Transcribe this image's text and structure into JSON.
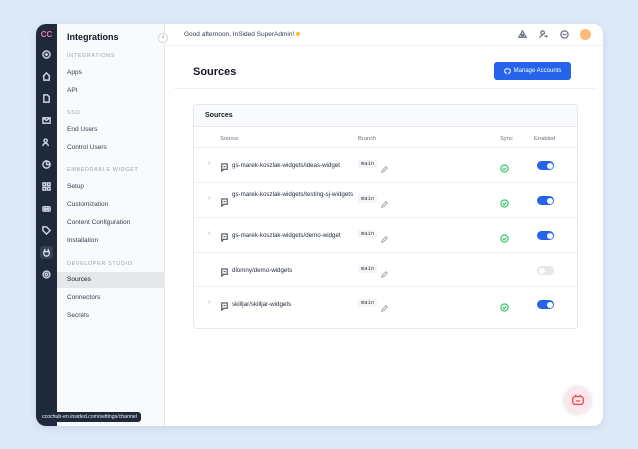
{
  "app": {
    "logo": "CC"
  },
  "nav": {
    "title": "Integrations",
    "collapse_glyph": "‹",
    "sections": [
      {
        "label": "INTEGRATIONS",
        "items": [
          "Apps",
          "API"
        ]
      },
      {
        "label": "SSO",
        "items": [
          "End Users",
          "Control Users"
        ]
      },
      {
        "label": "EMBEDDABLE WIDGET",
        "items": [
          "Setup",
          "Customization",
          "Content Configuration",
          "Installation"
        ]
      },
      {
        "label": "DEVELOPER STUDIO",
        "items": [
          "Sources",
          "Connectors",
          "Secrets"
        ]
      }
    ],
    "active_item": "Sources"
  },
  "topbar": {
    "greeting": "Good afternoon, InSided SuperAdmin!"
  },
  "page": {
    "title": "Sources",
    "manage_button": "Manage Accounts"
  },
  "card": {
    "title": "Sources",
    "columns": {
      "source": "Source",
      "branch": "Branch",
      "sync": "Sync",
      "enabled": "Enabled"
    },
    "rows": [
      {
        "source": "gs-marek-koszlak-widgets/ideas-widget",
        "branch": "main",
        "expandable": true,
        "synced": true,
        "enabled": true
      },
      {
        "source": "gs-marek-koszlak-widgets/testing-sj-widgets",
        "branch": "main",
        "expandable": true,
        "synced": true,
        "enabled": true
      },
      {
        "source": "gs-marek-koszlak-widgets/demo-widget",
        "branch": "main",
        "expandable": true,
        "synced": true,
        "enabled": true
      },
      {
        "source": "dlomny/demo-widgets",
        "branch": "main",
        "expandable": false,
        "synced": false,
        "enabled": false
      },
      {
        "source": "skilljar/skilljar-widgets",
        "branch": "main",
        "expandable": true,
        "synced": true,
        "enabled": true
      }
    ]
  },
  "status_url": "ccochub-en.insided.com/settings/channel",
  "colors": {
    "accent": "#2563eb",
    "sync_ok": "#22c55e",
    "rail": "#1e293b"
  }
}
